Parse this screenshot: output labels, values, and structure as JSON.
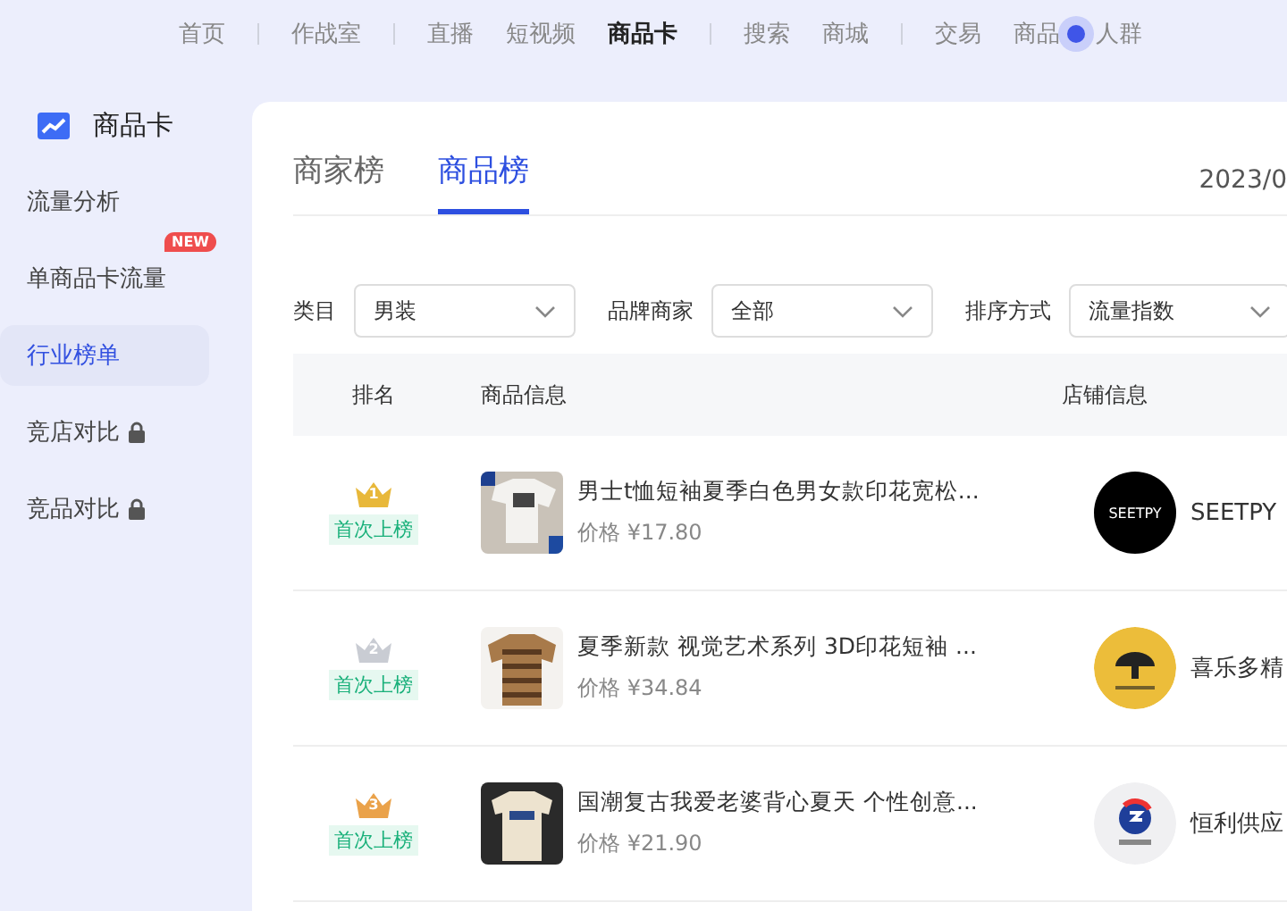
{
  "top_nav": [
    {
      "label": "首页",
      "selected": false,
      "divider_after": true
    },
    {
      "label": "作战室",
      "selected": false,
      "divider_after": true
    },
    {
      "label": "直播",
      "selected": false,
      "divider_after": false
    },
    {
      "label": "短视频",
      "selected": false,
      "divider_after": false
    },
    {
      "label": "商品卡",
      "selected": true,
      "divider_after": true
    },
    {
      "label": "搜索",
      "selected": false,
      "divider_after": false
    },
    {
      "label": "商城",
      "selected": false,
      "divider_after": true
    },
    {
      "label": "交易",
      "selected": false,
      "divider_after": false
    },
    {
      "label": "商品",
      "selected": false,
      "divider_after": false,
      "dot_after": true
    },
    {
      "label": "人群",
      "selected": false,
      "divider_after": false
    }
  ],
  "sidebar": {
    "title": "商品卡",
    "items": [
      {
        "label": "流量分析",
        "selected": false,
        "locked": false
      },
      {
        "label": "单商品卡流量",
        "selected": false,
        "locked": false,
        "badge": "NEW"
      },
      {
        "label": "行业榜单",
        "selected": true,
        "locked": false
      },
      {
        "label": "竞店对比",
        "selected": false,
        "locked": true
      },
      {
        "label": "竞品对比",
        "selected": false,
        "locked": true
      }
    ]
  },
  "tabs": [
    {
      "label": "商家榜",
      "selected": false
    },
    {
      "label": "商品榜",
      "selected": true
    }
  ],
  "date": "2023/0",
  "filters": [
    {
      "label": "类目",
      "value": "男装"
    },
    {
      "label": "品牌商家",
      "value": "全部"
    },
    {
      "label": "排序方式",
      "value": "流量指数"
    }
  ],
  "table": {
    "columns": [
      "排名",
      "商品信息",
      "店铺信息"
    ],
    "rows": [
      {
        "rank": "1",
        "color": "#e8b83a",
        "tag": "首次上榜",
        "title": "男士t恤短袖夏季白色男女款印花宽松...",
        "price": "价格 ¥17.80",
        "store_logo": "SEETPY",
        "store_name": "SEETPY"
      },
      {
        "rank": "2",
        "color": "#c9ccd3",
        "tag": "首次上榜",
        "title": "夏季新款 视觉艺术系列 3D印花短袖 ...",
        "price": "价格 ¥34.84",
        "store_name": "喜乐多精"
      },
      {
        "rank": "3",
        "color": "#eaa24a",
        "tag": "首次上榜",
        "title": "国潮复古我爱老婆背心夏天 个性创意...",
        "price": "价格 ¥21.90",
        "store_name": "恒利供应"
      }
    ]
  }
}
